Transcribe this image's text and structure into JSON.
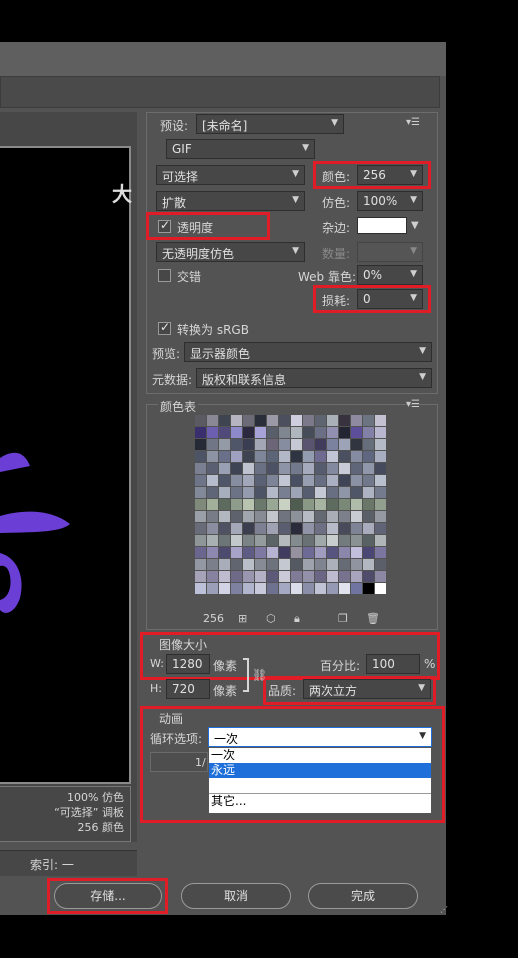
{
  "window": {
    "index_label": "索引: 一"
  },
  "preview": {
    "big_char": "大",
    "info": [
      "100% 仿色",
      "“可选择” 调板",
      "256 颜色"
    ]
  },
  "preset": {
    "label": "预设:",
    "value": "[未命名]"
  },
  "format": {
    "value": "GIF"
  },
  "reduction": {
    "value": "可选择"
  },
  "dither_algo": {
    "value": "扩散"
  },
  "colors": {
    "label": "颜色:",
    "value": "256"
  },
  "dither": {
    "label": "仿色:",
    "value": "100%"
  },
  "transparency": {
    "label": "透明度",
    "checked": true
  },
  "matte": {
    "label": "杂边:"
  },
  "transparency_dither": {
    "value": "无透明度仿色"
  },
  "amount": {
    "label": "数量:"
  },
  "interlace": {
    "label": "交错",
    "checked": false
  },
  "web_snap": {
    "label": "Web 靠色:",
    "value": "0%"
  },
  "lossy": {
    "label": "损耗:",
    "value": "0"
  },
  "convert_srgb": {
    "label": "转换为 sRGB",
    "checked": true
  },
  "preview_mode": {
    "label": "预览:",
    "value": "显示器颜色"
  },
  "metadata": {
    "label": "元数据:",
    "value": "版权和联系信息"
  },
  "color_table": {
    "title": "颜色表",
    "count": "256",
    "colors": [
      "#5b5a62",
      "#8a8894",
      "#3f4550",
      "#b7b4c2",
      "#6d6a78",
      "#2a2d3a",
      "#9b99a8",
      "#4b4f5e",
      "#cfcde0",
      "#7c7a8a",
      "#5e6470",
      "#a9b0b8",
      "#38323f",
      "#8f8aa0",
      "#6b7480",
      "#c4c2d2",
      "#3a2f6e",
      "#6d5fb0",
      "#4f4a7a",
      "#8e8ac9",
      "#2c2840",
      "#a7a2d8",
      "#585f6a",
      "#7f8690",
      "#b0b6be",
      "#464c58",
      "#6a6f85",
      "#9190b0",
      "#232533",
      "#5d4e9a",
      "#8380a8",
      "#b9b6d0",
      "#262a36",
      "#707686",
      "#949aa6",
      "#50566a",
      "#3b3e52",
      "#a3a7b5",
      "#6c6578",
      "#878da0",
      "#c6c9d3",
      "#5a5470",
      "#423c5c",
      "#7b82a0",
      "#9ea4b8",
      "#31353f",
      "#666e7c",
      "#b4bac6",
      "#4d5466",
      "#8d93a3",
      "#6a708a",
      "#a0a0c0",
      "#3d4350",
      "#7e869a",
      "#5c6478",
      "#b2b8c8",
      "#2f3442",
      "#939bb0",
      "#6f6a90",
      "#c0c4d4",
      "#4a5060",
      "#858ca2",
      "#5f6680",
      "#a8aec0",
      "#7a7f92",
      "#5a6072",
      "#9aa0b4",
      "#3e4454",
      "#bfc3d0",
      "#6b7184",
      "#4c5264",
      "#8d94a8",
      "#737a8e",
      "#a5abbd",
      "#565c6e",
      "#838aa0",
      "#c9ccd8",
      "#60667a",
      "#9097ab",
      "#454b5c",
      "#6e7588",
      "#b6bccc",
      "#50566a",
      "#868da1",
      "#a2a8ba",
      "#5b6175",
      "#7d8498",
      "#c2c6d4",
      "#4a5064",
      "#979eb2",
      "#676e82",
      "#aab0c2",
      "#3f4556",
      "#8a91a5",
      "#71788c",
      "#b9bfcd",
      "#828998",
      "#5f6678",
      "#a7aebe",
      "#6c7386",
      "#949bae",
      "#4d5466",
      "#b3b9c8",
      "#787f92",
      "#9da4b6",
      "#565d70",
      "#c5c9d6",
      "#686f82",
      "#8f96a8",
      "#4f5668",
      "#adb3c3",
      "#747b8e",
      "#7f8a7a",
      "#a2b09a",
      "#5d6a5e",
      "#8e9c8c",
      "#b8c4b0",
      "#6b786c",
      "#99a894",
      "#c9d2c2",
      "#4f5c50",
      "#8a9886",
      "#a7b4a2",
      "#5e6b5f",
      "#7a8878",
      "#b0bcaa",
      "#6a7768",
      "#939f8e",
      "#9ba0a8",
      "#777c86",
      "#b3b8c0",
      "#5d626c",
      "#a0a5ae",
      "#868b94",
      "#c2c6cc",
      "#6f747e",
      "#8c919a",
      "#b7bcc4",
      "#646972",
      "#a9aeb6",
      "#7b808a",
      "#c8ccd2",
      "#5a5f68",
      "#959aa2",
      "#686c78",
      "#8a8ea0",
      "#4e5262",
      "#a4a8b8",
      "#3b3e4e",
      "#7c8092",
      "#9fa2b2",
      "#5a5e70",
      "#2a2c3c",
      "#8f93a5",
      "#6c7082",
      "#b7bac8",
      "#484b5c",
      "#7f8396",
      "#a9acbc",
      "#616476",
      "#8f9698",
      "#a9b0b2",
      "#6e7578",
      "#c3c9ca",
      "#7c8386",
      "#959c9e",
      "#5d6467",
      "#b5bbbc",
      "#848b8e",
      "#6a7174",
      "#a1a8aa",
      "#c8cdcd",
      "#747b7e",
      "#8b9294",
      "#5a6164",
      "#b0b6b7",
      "#6a6690",
      "#8c88b0",
      "#4d4a70",
      "#a7a3c8",
      "#5e5b84",
      "#7d79a2",
      "#b5b2d2",
      "#3f3c60",
      "#95919e",
      "#6e6a96",
      "#a09cc0",
      "#575480",
      "#8a86ac",
      "#c2bfdc",
      "#4a4774",
      "#7a76a0",
      "#9398a4",
      "#7a7f8b",
      "#a8adb9",
      "#60656f",
      "#b9bec8",
      "#868b96",
      "#6d727c",
      "#c4c8d0",
      "#545962",
      "#9da2ad",
      "#7f8490",
      "#abb0ba",
      "#666b76",
      "#8f94a0",
      "#b3b7c1",
      "#5a5f6a",
      "#a6a2b8",
      "#8682a0",
      "#c0bcd0",
      "#6e6a88",
      "#9a96b0",
      "#b4b0c6",
      "#5d5978",
      "#cbc8d8",
      "#807c98",
      "#9390aa",
      "#6a6684",
      "#bebad0",
      "#77738e",
      "#a8a4be",
      "#4f4b6a",
      "#8c88a4",
      "#bcc0d8",
      "#9c9fb8",
      "#d2d4e6",
      "#7e82a0",
      "#b0b4cc",
      "#c8cadc",
      "#6e7290",
      "#a4a8c2",
      "#dadcea",
      "#8a8ea8",
      "#c0c3d6",
      "#9699b4",
      "#e0e2ee",
      "#7074a0",
      "#000000",
      "#ffffff"
    ]
  },
  "image_size": {
    "title": "图像大小",
    "w_label": "W:",
    "w_value": "1280",
    "w_unit": "像素",
    "h_label": "H:",
    "h_value": "720",
    "h_unit": "像素",
    "percent_label": "百分比:",
    "percent_value": "100",
    "percent_unit": "%",
    "quality_label": "品质:",
    "quality_value": "两次立方"
  },
  "animation": {
    "title": "动画",
    "loop_label": "循环选项:",
    "loop_value": "一次",
    "frame_partial": "1/",
    "options": [
      "一次",
      "永远",
      "",
      "其它..."
    ]
  },
  "buttons": {
    "save": "存储...",
    "cancel": "取消",
    "done": "完成"
  }
}
